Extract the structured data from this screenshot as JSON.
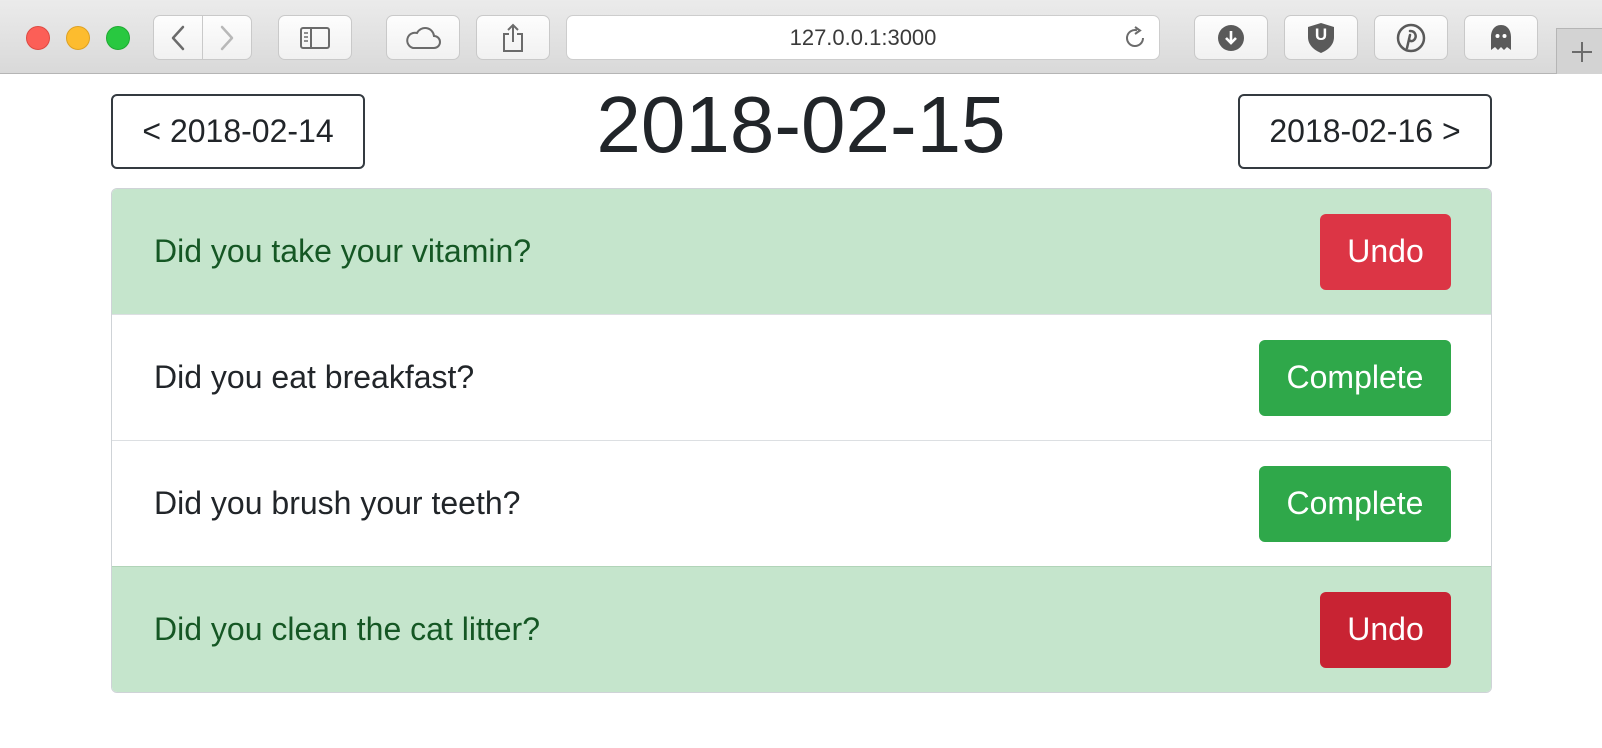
{
  "browser": {
    "url": "127.0.0.1:3000",
    "icons": {
      "back": "chevron-left-icon",
      "forward": "chevron-right-icon",
      "sidebar": "sidebar-icon",
      "cloud": "cloud-icon",
      "share": "share-icon",
      "reload": "reload-icon",
      "download": "download-icon",
      "extension_u": "ublock-icon",
      "pinterest": "pinterest-icon",
      "ghost": "ghostery-icon",
      "new_tab": "plus-icon"
    },
    "extension_u_letter": "U"
  },
  "page": {
    "title": "2018-02-15",
    "prev_label": "< 2018-02-14",
    "next_label": "2018-02-16 >"
  },
  "habits": [
    {
      "question": "Did you take your vitamin?",
      "done": true,
      "action": "Undo"
    },
    {
      "question": "Did you eat breakfast?",
      "done": false,
      "action": "Complete"
    },
    {
      "question": "Did you brush your teeth?",
      "done": false,
      "action": "Complete"
    },
    {
      "question": "Did you clean the cat litter?",
      "done": true,
      "action": "Undo"
    }
  ],
  "colors": {
    "done_row": "#c5e5cc",
    "done_text": "#155724",
    "undo": "#dc3545",
    "complete": "#2fa84a"
  }
}
